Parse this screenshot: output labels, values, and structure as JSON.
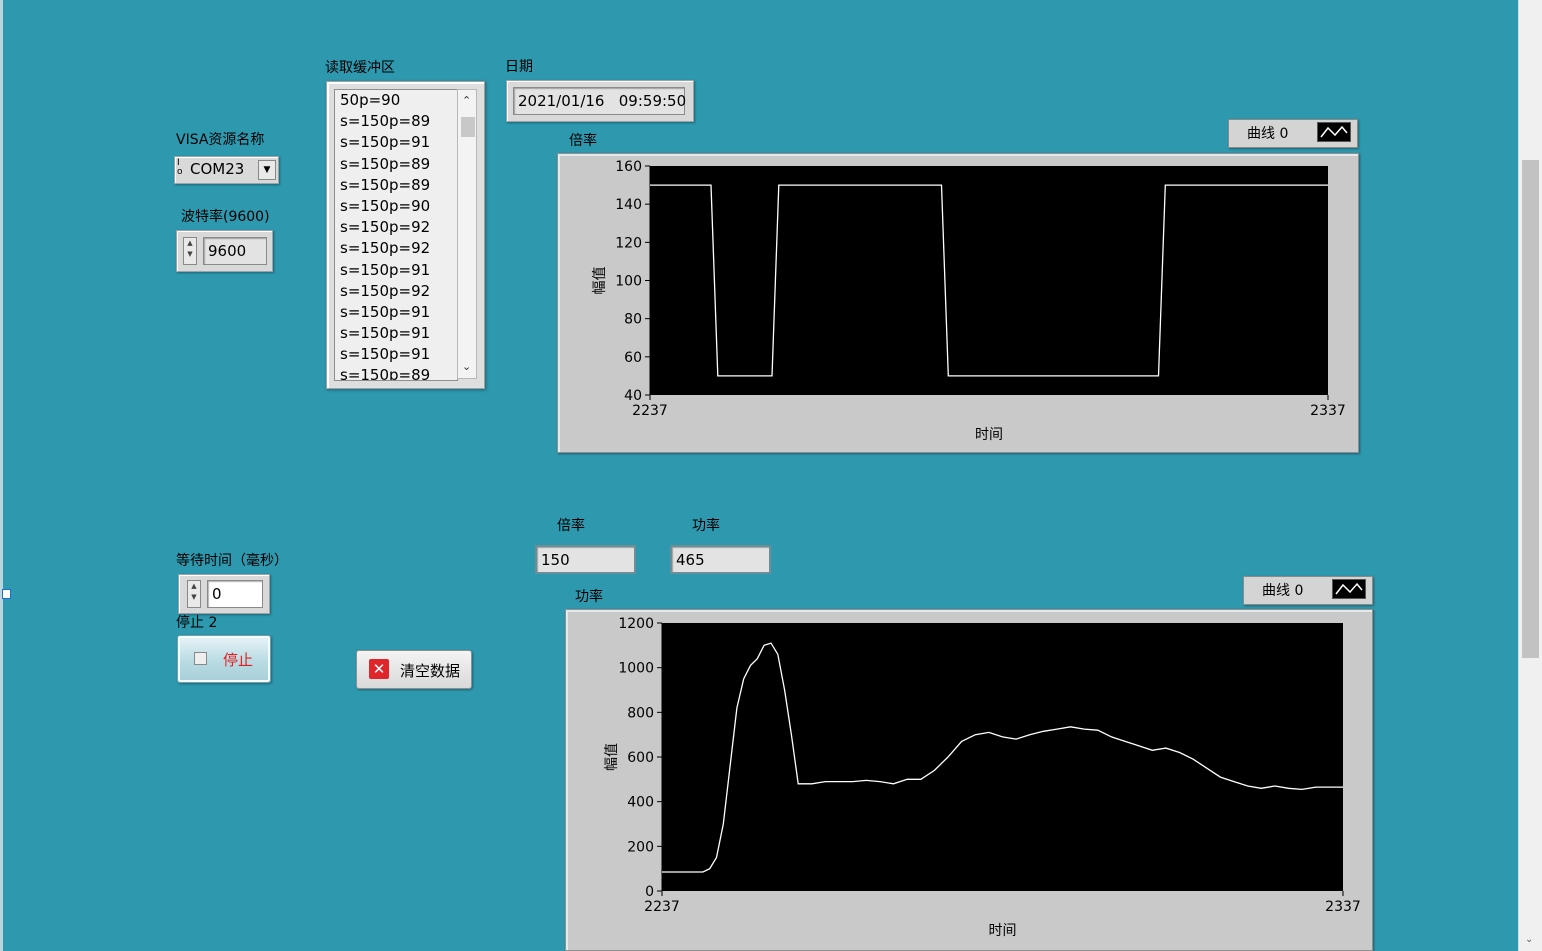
{
  "visa": {
    "label": "VISA资源名称",
    "io_icon": "I/O",
    "value": "COM23"
  },
  "baud": {
    "label": "波特率(9600)",
    "value": "9600"
  },
  "buffer": {
    "label": "读取缓冲区",
    "items": [
      "50p=90",
      "s=150p=89",
      "s=150p=91",
      "s=150p=89",
      "s=150p=89",
      "s=150p=90",
      "s=150p=92",
      "s=150p=92",
      "s=150p=91",
      "s=150p=92",
      "s=150p=91",
      "s=150p=91",
      "s=150p=91",
      "s=150p=89"
    ]
  },
  "date": {
    "label": "日期",
    "value": "2021/01/16   09:59:50"
  },
  "wait": {
    "label": "等待时间（毫秒）",
    "value": "0"
  },
  "stop": {
    "label": "停止 2",
    "button_text": "停止"
  },
  "clear": {
    "button_text": "清空数据"
  },
  "indicators": {
    "ratio_label": "倍率",
    "ratio_value": "150",
    "power_label": "功率",
    "power_value": "465"
  },
  "chart_data": [
    {
      "type": "line",
      "title": "倍率",
      "legend": "曲线 0",
      "xlabel": "时间",
      "ylabel": "幅值",
      "xlim": [
        2237,
        2337
      ],
      "ylim": [
        40,
        160
      ],
      "yticks": [
        40,
        60,
        80,
        100,
        120,
        140,
        160
      ],
      "xticks": [
        2237,
        2337
      ],
      "series": [
        {
          "name": "曲线 0",
          "x": [
            2237,
            2246,
            2247,
            2255,
            2256,
            2280,
            2281,
            2312,
            2313,
            2337
          ],
          "y": [
            150,
            150,
            50,
            50,
            150,
            150,
            50,
            50,
            150,
            150
          ]
        }
      ]
    },
    {
      "type": "line",
      "title": "功率",
      "legend": "曲线 0",
      "xlabel": "时间",
      "ylabel": "幅值",
      "xlim": [
        2237,
        2337
      ],
      "ylim": [
        0,
        1200
      ],
      "yticks": [
        0,
        200,
        400,
        600,
        800,
        1000,
        1200
      ],
      "xticks": [
        2237,
        2337
      ],
      "series": [
        {
          "name": "曲线 0",
          "x": [
            2237,
            2240,
            2243,
            2244,
            2245,
            2246,
            2247,
            2248,
            2249,
            2250,
            2251,
            2252,
            2253,
            2254,
            2255,
            2256,
            2257,
            2259,
            2261,
            2263,
            2265,
            2267,
            2269,
            2271,
            2273,
            2275,
            2277,
            2279,
            2281,
            2283,
            2285,
            2287,
            2289,
            2291,
            2293,
            2295,
            2297,
            2299,
            2301,
            2303,
            2305,
            2307,
            2309,
            2311,
            2313,
            2315,
            2317,
            2319,
            2321,
            2323,
            2325,
            2327,
            2329,
            2331,
            2333,
            2335,
            2337
          ],
          "y": [
            85,
            85,
            85,
            100,
            150,
            300,
            560,
            820,
            950,
            1010,
            1040,
            1100,
            1110,
            1060,
            900,
            700,
            480,
            480,
            490,
            490,
            490,
            495,
            490,
            480,
            500,
            500,
            540,
            600,
            670,
            700,
            710,
            690,
            680,
            700,
            715,
            725,
            735,
            725,
            720,
            690,
            670,
            650,
            630,
            640,
            620,
            590,
            550,
            510,
            490,
            470,
            460,
            470,
            460,
            455,
            465,
            465,
            465
          ]
        }
      ]
    }
  ]
}
